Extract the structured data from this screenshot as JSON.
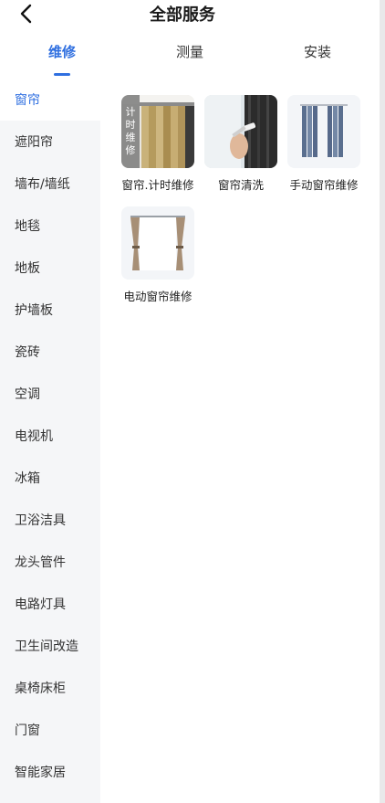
{
  "header": {
    "title": "全部服务"
  },
  "tabs": [
    {
      "label": "维修",
      "active": true
    },
    {
      "label": "测量",
      "active": false
    },
    {
      "label": "安装",
      "active": false
    }
  ],
  "sidebar": {
    "items": [
      {
        "label": "窗帘",
        "active": true
      },
      {
        "label": "遮阳帘"
      },
      {
        "label": "墙布/墙纸"
      },
      {
        "label": "地毯"
      },
      {
        "label": "地板"
      },
      {
        "label": "护墙板"
      },
      {
        "label": "瓷砖"
      },
      {
        "label": "空调"
      },
      {
        "label": "电视机"
      },
      {
        "label": "冰箱"
      },
      {
        "label": "卫浴洁具"
      },
      {
        "label": "龙头管件"
      },
      {
        "label": "电路灯具"
      },
      {
        "label": "卫生间改造"
      },
      {
        "label": "桌椅床柜"
      },
      {
        "label": "门窗"
      },
      {
        "label": "智能家居"
      }
    ]
  },
  "services": [
    {
      "label": "窗帘.计时维修",
      "thumb_text": "计时维修",
      "icon": "timed-curtain-repair-image"
    },
    {
      "label": "窗帘清洗",
      "icon": "curtain-cleaning-image"
    },
    {
      "label": "手动窗帘维修",
      "icon": "manual-curtain-image"
    },
    {
      "label": "电动窗帘维修",
      "icon": "electric-curtain-image"
    }
  ],
  "colors": {
    "accent": "#2f6fe0",
    "sidebar_bg": "#f5f6f8"
  }
}
